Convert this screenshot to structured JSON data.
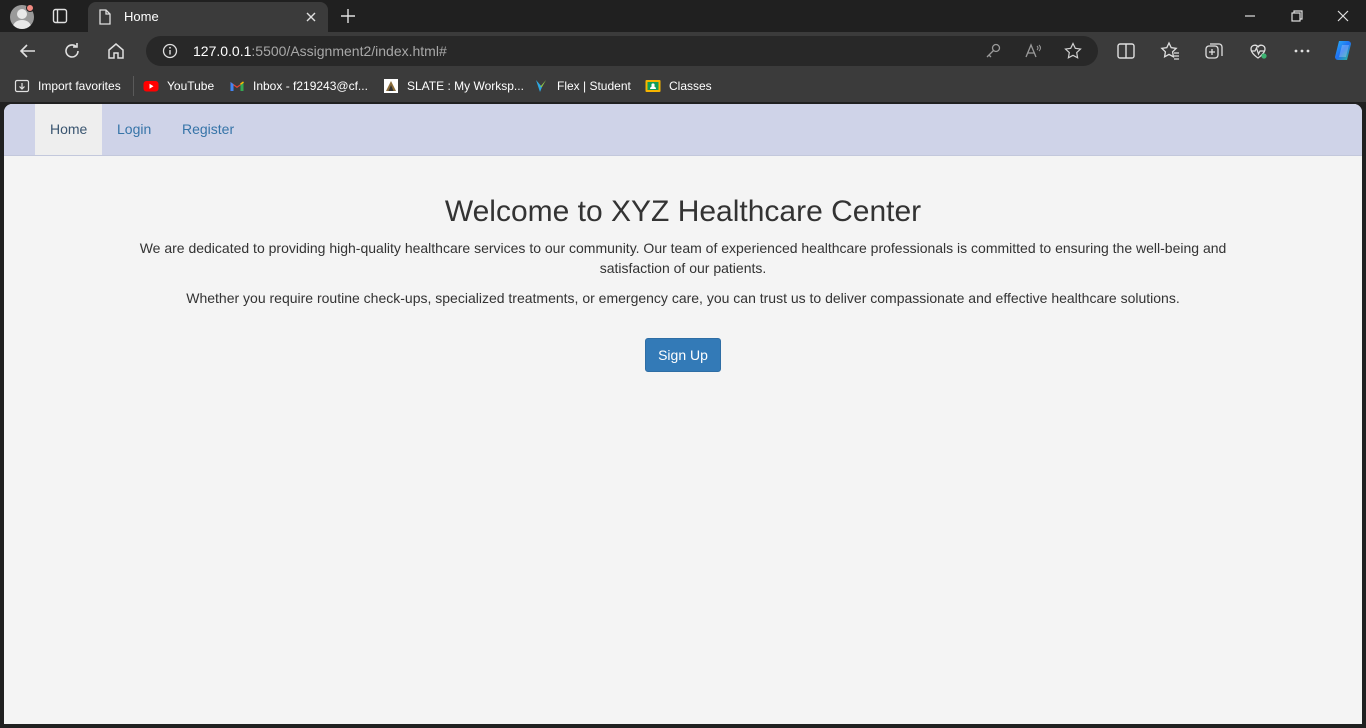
{
  "browser": {
    "tab": {
      "title": "Home"
    },
    "address": {
      "host": "127.0.0.1",
      "rest": ":5500/Assignment2/index.html#"
    },
    "favorites": [
      {
        "label": "Import favorites",
        "icon": "import-icon"
      },
      {
        "label": "YouTube",
        "icon": "youtube-icon"
      },
      {
        "label": "Inbox - f219243@cf...",
        "icon": "gmail-icon"
      },
      {
        "label": "SLATE : My Worksp...",
        "icon": "slate-icon"
      },
      {
        "label": "Flex | Student",
        "icon": "flex-icon"
      },
      {
        "label": "Classes",
        "icon": "classroom-icon"
      }
    ]
  },
  "page": {
    "nav": [
      {
        "label": "Home",
        "active": true
      },
      {
        "label": "Login",
        "active": false
      },
      {
        "label": "Register",
        "active": false
      }
    ],
    "heading": "Welcome to XYZ Healthcare Center",
    "paragraph1": "We are dedicated to providing high-quality healthcare services to our community. Our team of experienced healthcare professionals is committed to ensuring the well-being and satisfaction of our patients.",
    "paragraph2": "Whether you require routine check-ups, specialized treatments, or emergency care, you can trust us to deliver compassionate and effective healthcare solutions.",
    "signup_label": "Sign Up"
  },
  "colors": {
    "navbar_bg": "#cfd3e8",
    "link": "#3674a8",
    "button": "#337ab7",
    "page_bg": "#f4f4f4"
  }
}
